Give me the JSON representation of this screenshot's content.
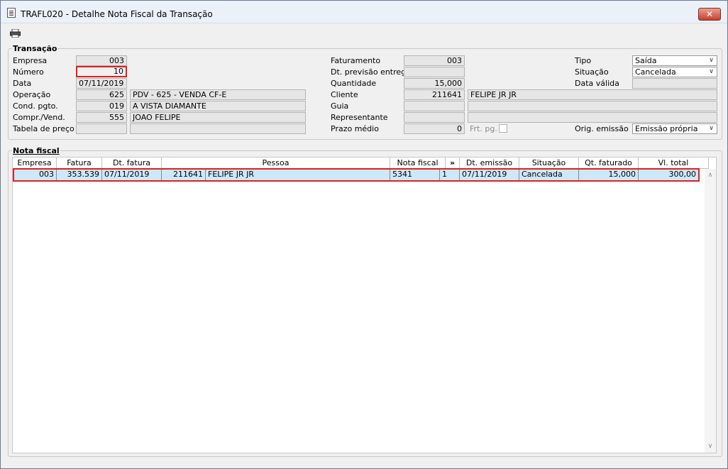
{
  "window": {
    "title": "TRAFL020 - Detalhe Nota Fiscal da Transação",
    "close_label": "✕"
  },
  "transacao": {
    "group_title": "Transação",
    "empresa": {
      "label": "Empresa",
      "value": "003"
    },
    "numero": {
      "label": "Número",
      "value": "10"
    },
    "data": {
      "label": "Data",
      "value": "07/11/2019"
    },
    "operacao": {
      "label": "Operação",
      "code": "625",
      "desc": "PDV - 625 -  VENDA CF-E"
    },
    "cond_pgto": {
      "label": "Cond. pgto.",
      "code": "019",
      "desc": "A VISTA DIAMANTE"
    },
    "compr_vend": {
      "label": "Compr./Vend.",
      "code": "555",
      "desc": "JOAO FELIPE"
    },
    "tabela_preco": {
      "label": "Tabela de preço",
      "code": "",
      "desc": ""
    },
    "faturamento": {
      "label": "Faturamento",
      "value": "003"
    },
    "dt_previsao": {
      "label": "Dt. previsão entrega",
      "value": ""
    },
    "quantidade": {
      "label": "Quantidade",
      "value": "15,000"
    },
    "cliente": {
      "label": "Cliente",
      "code": "211641",
      "name": "FELIPE JR JR"
    },
    "guia": {
      "label": "Guia",
      "code": "",
      "desc": ""
    },
    "representante": {
      "label": "Representante",
      "code": "",
      "desc": ""
    },
    "prazo_medio": {
      "label": "Prazo médio",
      "value": "0"
    },
    "frt_pg": {
      "label": "Frt. pg."
    },
    "tipo": {
      "label": "Tipo",
      "value": "Saída"
    },
    "situacao": {
      "label": "Situação",
      "value": "Cancelada"
    },
    "data_valida": {
      "label": "Data válida",
      "value": ""
    },
    "orig_emissao": {
      "label": "Orig. emissão",
      "value": "Emissão própria"
    }
  },
  "nota_fiscal": {
    "group_title": "Nota fiscal",
    "columns": [
      "Empresa",
      "Fatura",
      "Dt. fatura",
      "Pessoa",
      "Nota fiscal",
      "»",
      "Dt. emissão",
      "Situação",
      "Qt. faturado",
      "Vl. total"
    ],
    "rows": [
      {
        "empresa": "003",
        "fatura": "353.539",
        "dt_fatura": "07/11/2019",
        "pessoa_code": "211641",
        "pessoa_name": "FELIPE JR JR",
        "nota_fiscal": "5341",
        "serie": "1",
        "dt_emissao": "07/11/2019",
        "situacao": "Cancelada",
        "qt_faturado": "15,000",
        "vl_total": "300,00"
      }
    ]
  },
  "icons": {
    "print": "printer-icon",
    "document": "document-icon"
  }
}
